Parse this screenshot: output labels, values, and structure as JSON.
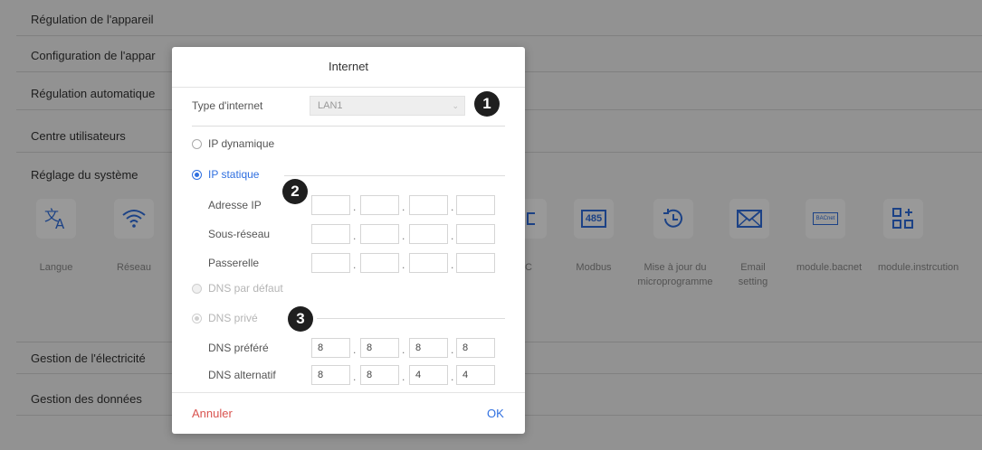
{
  "menu": {
    "rows": [
      "Régulation de l'appareil",
      "Configuration de l'appar",
      "Régulation automatique",
      "Centre utilisateurs",
      "Réglage du système",
      "Gestion de l'électricité",
      "Gestion des données"
    ]
  },
  "settings_icons": {
    "langue": "Langue",
    "reseau": "Réseau",
    "modbus_glyph": "485",
    "modbus": "Modbus",
    "update": "Mise à jour du microprogramme",
    "email": "Email setting",
    "bacnet_glyph": "BACnet",
    "bacnet": "module.bacnet",
    "instrcution": "module.instrcution",
    "partial_c": "C"
  },
  "dialog": {
    "title": "Internet",
    "internet_type_label": "Type d'internet",
    "internet_type_value": "LAN1",
    "radio_dynamic": "IP dynamique",
    "radio_static": "IP statique",
    "ip_label": "Adresse IP",
    "subnet_label": "Sous-réseau",
    "gateway_label": "Passerelle",
    "dns_default": "DNS par défaut",
    "dns_private": "DNS privé",
    "dns_pref_label": "DNS préféré",
    "dns_alt_label": "DNS alternatif",
    "dns_pref": [
      "8",
      "8",
      "8",
      "8"
    ],
    "dns_alt": [
      "8",
      "8",
      "4",
      "4"
    ],
    "cancel": "Annuler",
    "ok": "OK",
    "dot": "."
  },
  "badges": [
    "1",
    "2",
    "3"
  ],
  "colors": {
    "accent": "#2f6fe0",
    "cancel": "#d9534f",
    "badge": "#1f1f1f"
  }
}
